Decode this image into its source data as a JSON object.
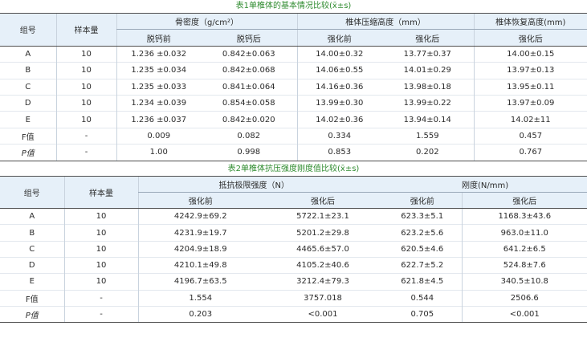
{
  "table1": {
    "caption": "表1单椎体的基本情况比较(x̄±s)",
    "col_group": "组号",
    "col_n": "样本量",
    "grp_bmd": "骨密度（g/cm²）",
    "grp_height": "椎体压缩高度（mm）",
    "grp_recover": "椎体恢复高度(mm)",
    "sub": [
      "脱钙前",
      "脱钙后",
      "强化前",
      "强化后",
      "强化后"
    ],
    "rows": [
      {
        "g": "A",
        "n": "10",
        "c": [
          "1.236 ±0.032",
          "0.842±0.063",
          "14.00±0.32",
          "13.77±0.37",
          "14.00±0.15"
        ]
      },
      {
        "g": "B",
        "n": "10",
        "c": [
          "1.235 ±0.034",
          "0.842±0.068",
          "14.06±0.55",
          "14.01±0.29",
          "13.97±0.13"
        ]
      },
      {
        "g": "C",
        "n": "10",
        "c": [
          "1.235 ±0.033",
          "0.841±0.064",
          "14.16±0.36",
          "13.98±0.18",
          "13.95±0.11"
        ]
      },
      {
        "g": "D",
        "n": "10",
        "c": [
          "1.234 ±0.039",
          "0.854±0.058",
          "13.99±0.30",
          "13.99±0.22",
          "13.97±0.09"
        ]
      },
      {
        "g": "E",
        "n": "10",
        "c": [
          "1.236 ±0.037",
          "0.842±0.020",
          "14.02±0.36",
          "13.94±0.14",
          "14.02±11"
        ]
      },
      {
        "g": "F值",
        "n": "-",
        "c": [
          "0.009",
          "0.082",
          "0.334",
          "1.559",
          "0.457"
        ]
      },
      {
        "g": "P值",
        "n": "-",
        "c": [
          "1.00",
          "0.998",
          "0.853",
          "0.202",
          "0.767"
        ]
      }
    ]
  },
  "table2": {
    "caption": "表2单椎体抗压强度刚度值比较(x̄±s)",
    "col_group": "组号",
    "col_n": "样本量",
    "grp_strength": "抵抗极限强度（N）",
    "grp_stiff": "刚度(N/mm)",
    "sub": [
      "强化前",
      "强化后",
      "强化前",
      "强化后"
    ],
    "rows": [
      {
        "g": "A",
        "n": "10",
        "c": [
          "4242.9±69.2",
          "5722.1±23.1",
          "623.3±5.1",
          "1168.3±43.6"
        ]
      },
      {
        "g": "B",
        "n": "10",
        "c": [
          "4231.9±19.7",
          "5201.2±29.8",
          "623.2±5.6",
          "963.0±11.0"
        ]
      },
      {
        "g": "C",
        "n": "10",
        "c": [
          "4204.9±18.9",
          "4465.6±57.0",
          "620.5±4.6",
          "641.2±6.5"
        ]
      },
      {
        "g": "D",
        "n": "10",
        "c": [
          "4210.1±49.8",
          "4105.2±40.6",
          "622.7±5.2",
          "524.8±7.6"
        ]
      },
      {
        "g": "E",
        "n": "10",
        "c": [
          "4196.7±63.5",
          "3212.4±79.3",
          "621.8±4.5",
          "340.5±10.8"
        ]
      },
      {
        "g": "F值",
        "n": "-",
        "c": [
          "1.554",
          "3757.018",
          "0.544",
          "2506.6"
        ]
      },
      {
        "g": "P值",
        "n": "-",
        "c": [
          "0.203",
          "<0.001",
          "0.705",
          "<0.001"
        ]
      }
    ]
  }
}
